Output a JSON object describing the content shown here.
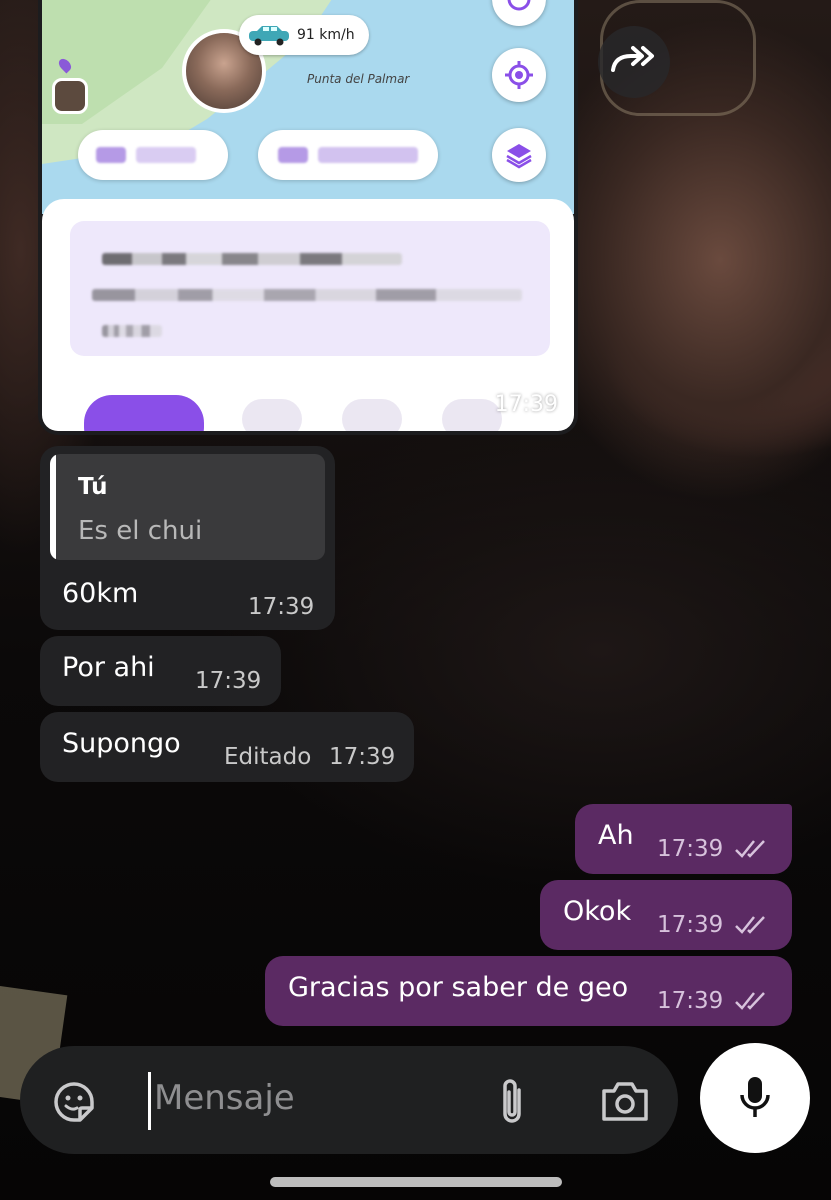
{
  "image_message": {
    "speed": "91 km/h",
    "place": "Punta del Palmar",
    "time": "17:39"
  },
  "incoming": [
    {
      "reply_quote": {
        "author": "Tú",
        "text": "Es el chui"
      },
      "text": "60km",
      "time": "17:39"
    },
    {
      "text": "Por ahi",
      "time": "17:39"
    },
    {
      "text": "Supongo",
      "edited": "Editado",
      "time": "17:39"
    }
  ],
  "outgoing": [
    {
      "text": "Ah",
      "time": "17:39"
    },
    {
      "text": "Okok",
      "time": "17:39"
    },
    {
      "text": "Gracias por saber de geo",
      "time": "17:39"
    }
  ],
  "composer": {
    "placeholder": "Mensaje"
  },
  "colors": {
    "incoming_bubble": "#222224",
    "outgoing_bubble": "#5b2a63",
    "composer_bg": "#1f2021",
    "map_water": "#aad9ee",
    "accent_purple": "#8a4fe8"
  },
  "icons": {
    "forward": "forward-icon",
    "sticker": "sticker-icon",
    "attach": "paperclip-icon",
    "camera": "camera-icon",
    "mic": "microphone-icon",
    "read_receipt": "double-check-icon"
  }
}
